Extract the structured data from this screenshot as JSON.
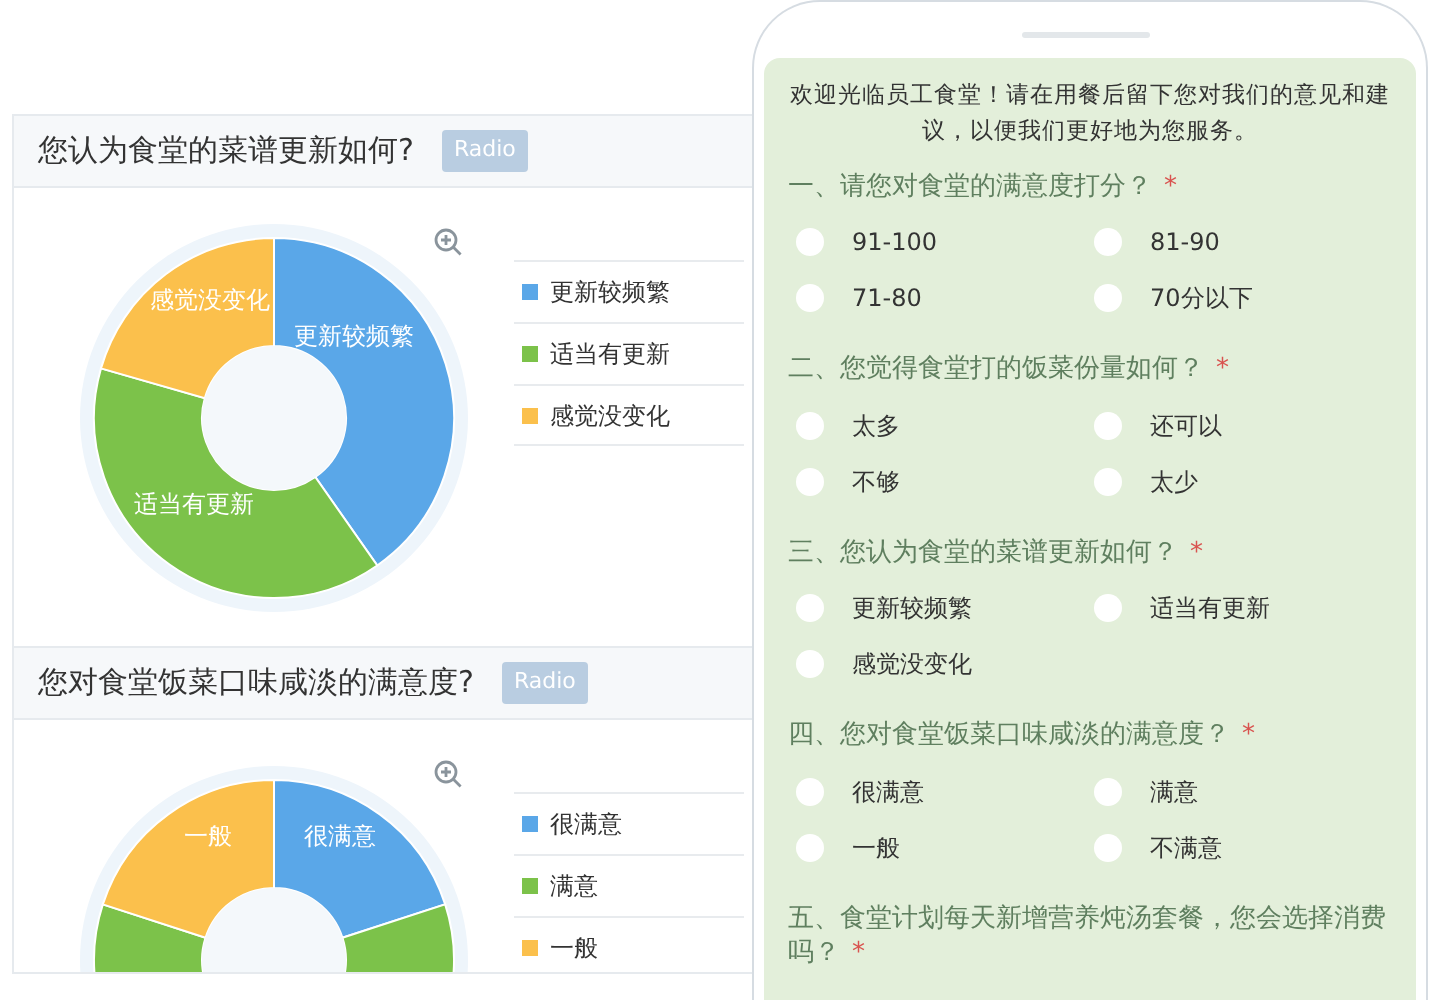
{
  "report_panels": [
    {
      "title": "您认为食堂的菜谱更新如何?",
      "badge": "Radio",
      "slice_labels": [
        "感觉没变化",
        "更新较频繁",
        "适当有更新"
      ],
      "slices": [
        {
          "legend": "更新较频繁",
          "color": "#5aa7e8"
        },
        {
          "legend": "适当有更新",
          "color": "#7cc24a"
        },
        {
          "legend": "感觉没变化",
          "color": "#fbc04c"
        }
      ]
    },
    {
      "title": "您对食堂饭菜口味咸淡的满意度?",
      "badge": "Radio",
      "slice_labels": [
        "一般",
        "很满意"
      ],
      "slices": [
        {
          "legend": "很满意",
          "color": "#5aa7e8"
        },
        {
          "legend": "满意",
          "color": "#7cc24a"
        },
        {
          "legend": "一般",
          "color": "#fbc04c"
        }
      ]
    }
  ],
  "survey": {
    "intro": "欢迎光临员工食堂！请在用餐后留下您对我们的意见和建议，以便我们更好地为您服务。",
    "questions": [
      {
        "title": "一、请您对食堂的满意度打分？",
        "required_mark": "*",
        "options": [
          {
            "label": "91-100",
            "selected": false
          },
          {
            "label": "81-90",
            "selected": false
          },
          {
            "label": "71-80",
            "selected": false
          },
          {
            "label": "70分以下",
            "selected": false
          }
        ]
      },
      {
        "title": "二、您觉得食堂打的饭菜份量如何？",
        "required_mark": "*",
        "options": [
          {
            "label": "太多",
            "selected": false
          },
          {
            "label": "还可以",
            "selected": false
          },
          {
            "label": "不够",
            "selected": false
          },
          {
            "label": "太少",
            "selected": false
          }
        ]
      },
      {
        "title": "三、您认为食堂的菜谱更新如何？",
        "required_mark": "*",
        "options": [
          {
            "label": "更新较频繁",
            "selected": false
          },
          {
            "label": "适当有更新",
            "selected": false
          },
          {
            "label": "感觉没变化",
            "selected": false
          }
        ]
      },
      {
        "title": "四、您对食堂饭菜口味咸淡的满意度？",
        "required_mark": "*",
        "options": [
          {
            "label": "很满意",
            "selected": false
          },
          {
            "label": "满意",
            "selected": false
          },
          {
            "label": "一般",
            "selected": false
          },
          {
            "label": "不满意",
            "selected": false
          }
        ]
      },
      {
        "title": "五、食堂计划每天新增营养炖汤套餐，您会选择消费吗？",
        "required_mark": "*"
      }
    ]
  }
}
